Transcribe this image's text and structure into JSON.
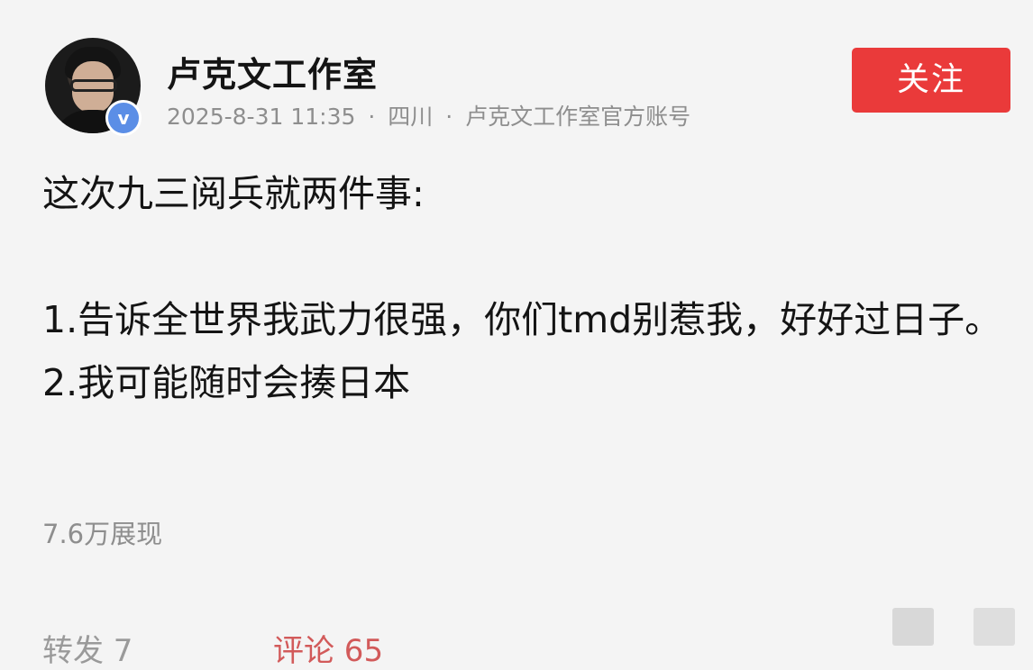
{
  "post": {
    "author": "卢克文工作室",
    "verified_badge": "v",
    "meta": {
      "timestamp": "2025-8-31 11:35",
      "separator": "·",
      "location": "四川",
      "account_type": "卢克文工作室官方账号"
    },
    "follow_label": "关注",
    "content": {
      "intro": "这次九三阅兵就两件事:",
      "point1": "1.告诉全世界我武力很强，你们tmd别惹我，好好过日子。",
      "point2": "2.我可能随时会揍日本"
    },
    "views": "7.6万展现",
    "actions": {
      "repost": "转发 7",
      "comment": "评论 65"
    }
  },
  "colors": {
    "follow_button": "#ea3a3a",
    "verified_badge": "#5b8ee6",
    "meta_text": "#8e8e8e",
    "comment_text": "#d25a5a"
  }
}
